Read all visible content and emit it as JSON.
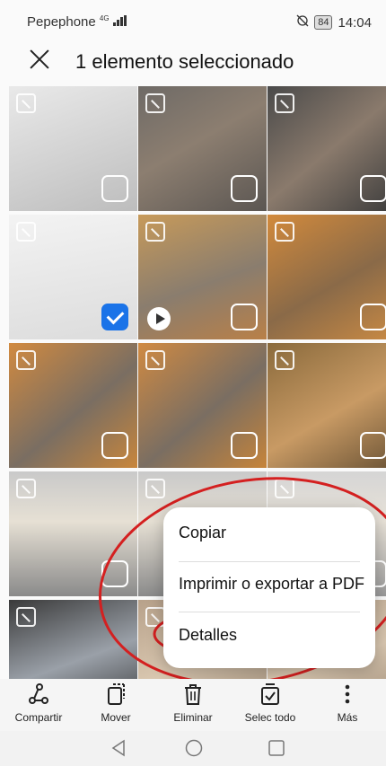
{
  "status": {
    "carrier": "Pepephone",
    "network": "4G",
    "battery": "84",
    "time": "14:04"
  },
  "header": {
    "title": "1 elemento seleccionado"
  },
  "photos": [
    {
      "kind": "note-router",
      "video": false,
      "selected": false
    },
    {
      "kind": "man-cat",
      "video": false,
      "selected": false
    },
    {
      "kind": "man-cat-2",
      "video": false,
      "selected": false
    },
    {
      "kind": "whiteboard",
      "video": false,
      "selected": true
    },
    {
      "kind": "two-cats",
      "video": true,
      "selected": false
    },
    {
      "kind": "cat-couch",
      "video": false,
      "selected": false
    },
    {
      "kind": "cats-sleeping",
      "video": false,
      "selected": false
    },
    {
      "kind": "cats-sleeping-2",
      "video": false,
      "selected": false
    },
    {
      "kind": "cat-chair",
      "video": false,
      "selected": false
    },
    {
      "kind": "building",
      "video": false,
      "selected": false
    },
    {
      "kind": "building-2",
      "video": false,
      "selected": false
    },
    {
      "kind": "building-3",
      "video": false,
      "selected": false
    },
    {
      "kind": "plaque",
      "video": false,
      "selected": false
    },
    {
      "kind": "people",
      "video": false,
      "selected": false
    },
    {
      "kind": "people-2",
      "video": false,
      "selected": false
    }
  ],
  "menu": {
    "items": [
      "Copiar",
      "Imprimir o exportar a PDF",
      "Detalles"
    ]
  },
  "toolbar": {
    "share": "Compartir",
    "move": "Mover",
    "delete": "Eliminar",
    "select_all": "Selec todo",
    "more": "Más"
  },
  "colors": {
    "accent": "#1a73e8",
    "annotation": "#d42020"
  }
}
